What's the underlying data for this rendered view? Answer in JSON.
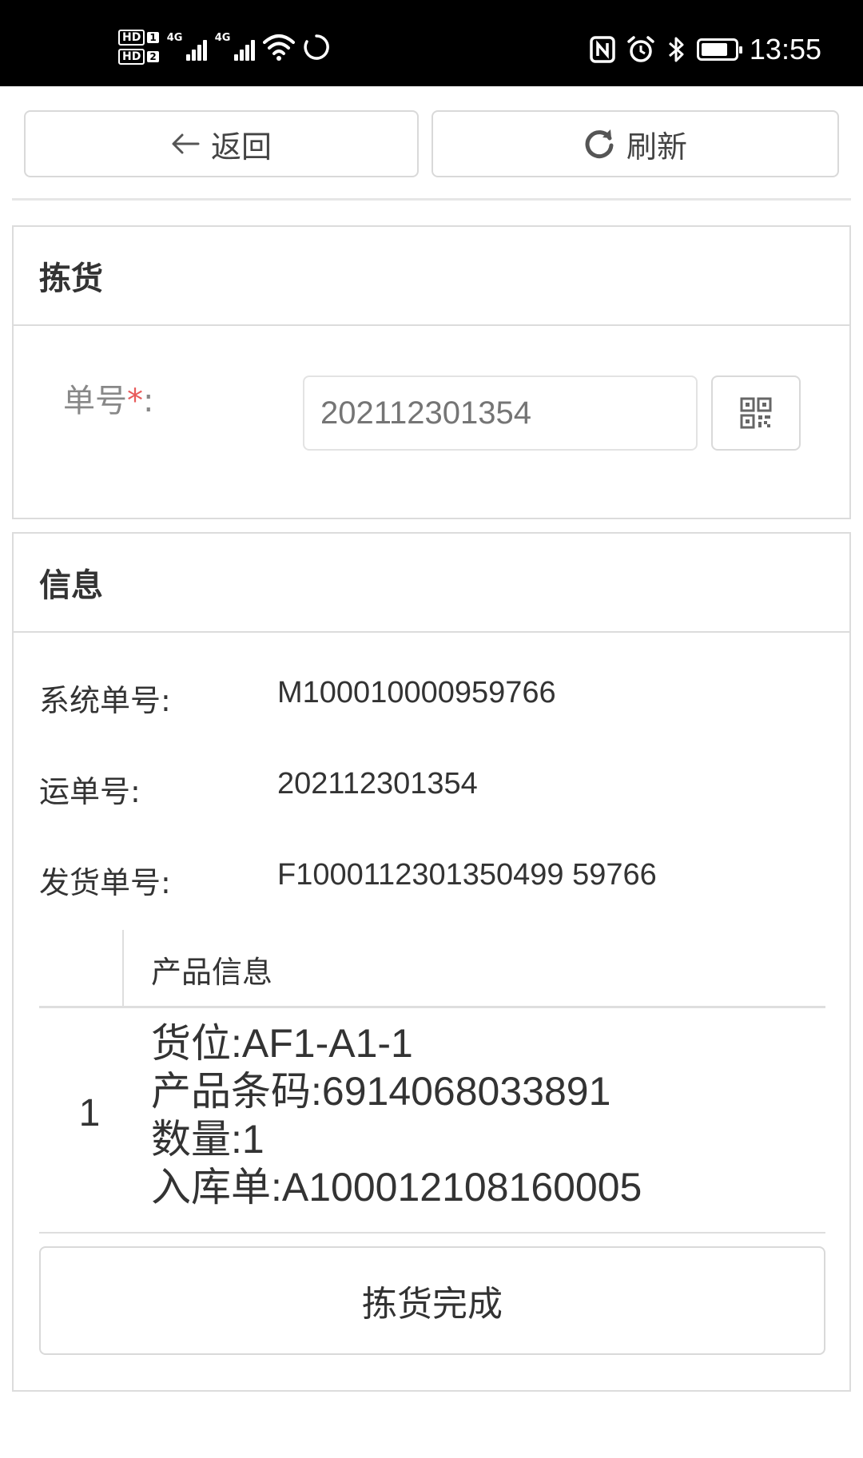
{
  "status_bar": {
    "hd1": "HD",
    "sim1": "1",
    "hd2": "HD",
    "sim2": "2",
    "net1": "4G",
    "net2": "4G",
    "time": "13:55",
    "battery_level": 0.8
  },
  "toolbar": {
    "back_label": "返回",
    "refresh_label": "刷新"
  },
  "pick_panel": {
    "title": "拣货",
    "order_label": "单号",
    "required_mark": "*",
    "colon": ":",
    "order_value": "202112301354"
  },
  "info_panel": {
    "title": "信息",
    "rows": [
      {
        "label": "系统单号:",
        "value": "M100010000959766"
      },
      {
        "label": "运单号:",
        "value": "202112301354"
      },
      {
        "label": "发货单号:",
        "value": "F1000112301350499 59766"
      }
    ],
    "product_table": {
      "header": "产品信息",
      "items": [
        {
          "index": "1",
          "location": "货位:AF1-A1-1",
          "barcode": "产品条码:6914068033891",
          "quantity": "数量:1",
          "inbound": "入库单:A100012108160005"
        }
      ]
    },
    "complete_label": "拣货完成"
  }
}
